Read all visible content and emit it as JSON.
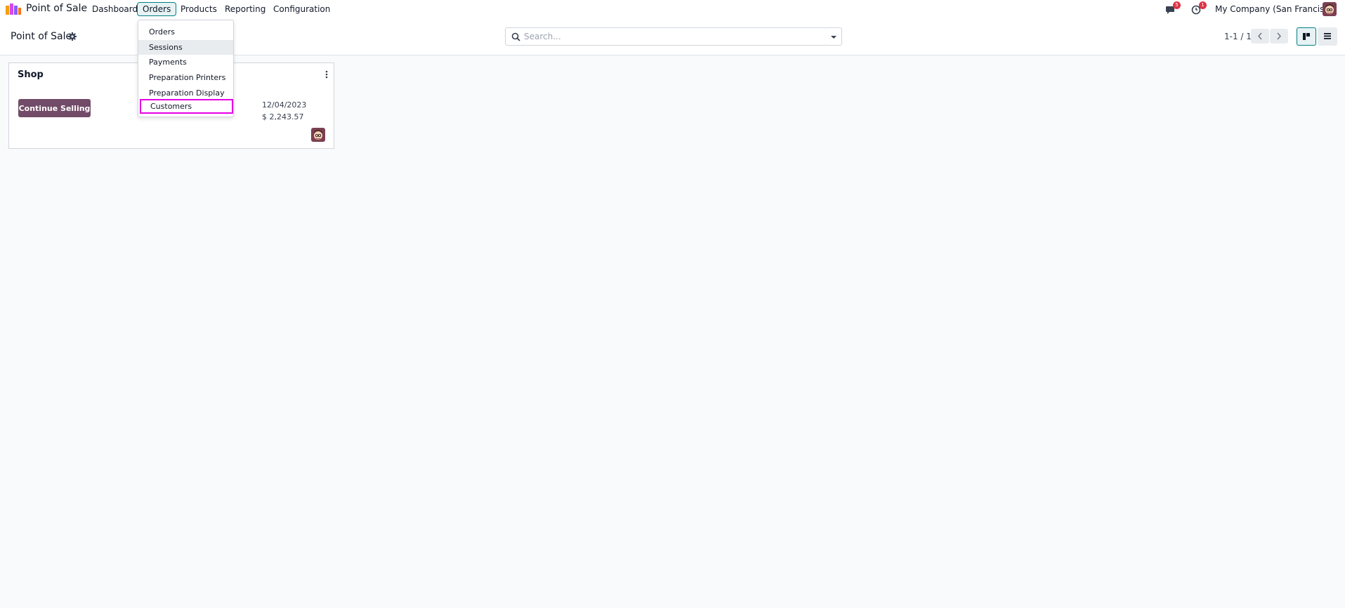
{
  "navbar": {
    "app_name": "Point of Sale",
    "menu": [
      {
        "label": "Dashboard"
      },
      {
        "label": "Orders"
      },
      {
        "label": "Products"
      },
      {
        "label": "Reporting"
      },
      {
        "label": "Configuration"
      }
    ],
    "messages_badge": "5",
    "activities_badge": "1",
    "company": "My Company (San Francisco)"
  },
  "control_panel": {
    "title": "Point of Sale",
    "search_placeholder": "Search...",
    "pager": "1-1 / 1"
  },
  "orders_menu": {
    "items": [
      {
        "label": "Orders"
      },
      {
        "label": "Sessions"
      },
      {
        "label": "Payments"
      },
      {
        "label": "Preparation Printers"
      },
      {
        "label": "Preparation Display"
      },
      {
        "label": "Customers"
      }
    ]
  },
  "card": {
    "title": "Shop",
    "button": "Continue Selling",
    "date": "12/04/2023",
    "amount": "$ 2,243.57"
  },
  "colors": {
    "brand": "#714b67",
    "accent": "#017e84",
    "highlight": "#e600e6",
    "badge": "#dc3545"
  },
  "icons": {
    "logo": "pos-logo-icon",
    "messages": "chat-icon",
    "activities": "clock-icon",
    "settings": "gear-icon",
    "search": "search-icon",
    "kanban": "kanban-view-icon",
    "list": "list-view-icon"
  }
}
